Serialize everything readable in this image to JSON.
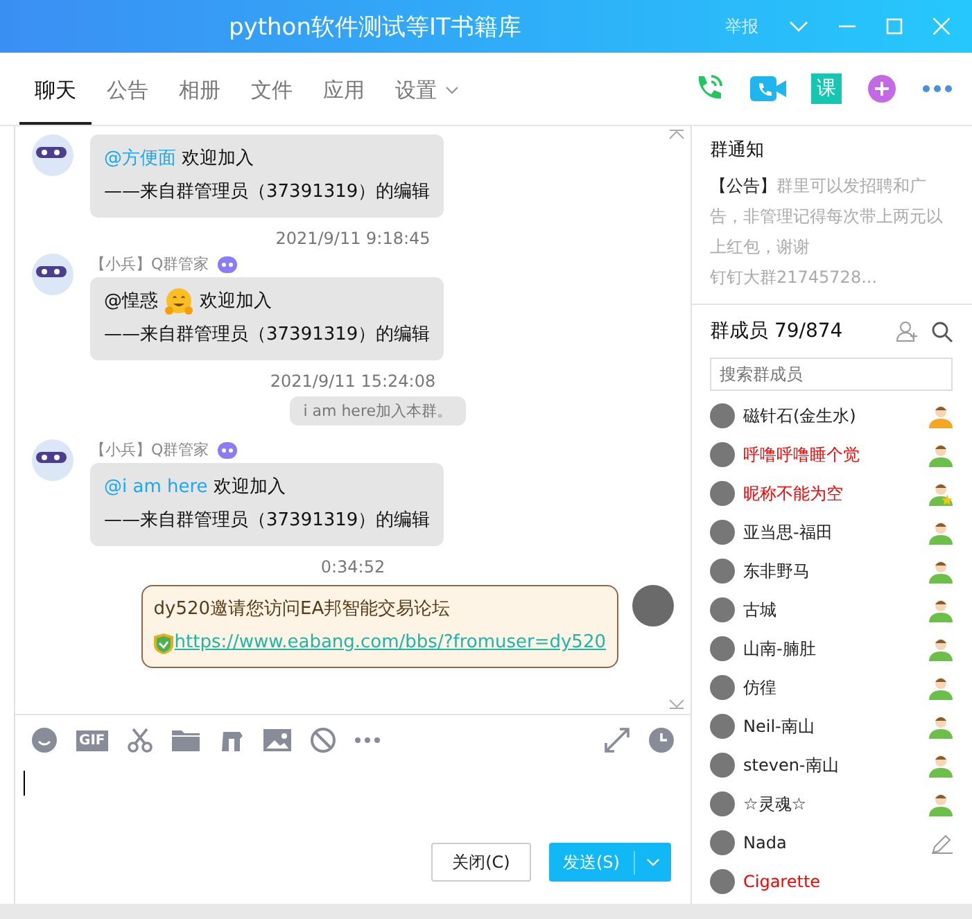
{
  "window": {
    "title": "python软件测试等IT书籍库",
    "report": "举报"
  },
  "tabs": [
    {
      "label": "聊天",
      "selected": true,
      "dropdown": false
    },
    {
      "label": "公告",
      "selected": false,
      "dropdown": false
    },
    {
      "label": "相册",
      "selected": false,
      "dropdown": false
    },
    {
      "label": "文件",
      "selected": false,
      "dropdown": false
    },
    {
      "label": "应用",
      "selected": false,
      "dropdown": false
    },
    {
      "label": "设置",
      "selected": false,
      "dropdown": true
    }
  ],
  "header_actions": [
    {
      "kind": "phone"
    },
    {
      "kind": "video"
    },
    {
      "kind": "lesson",
      "label": "课"
    },
    {
      "kind": "plus"
    },
    {
      "kind": "more"
    }
  ],
  "messages": [
    {
      "kind": "bot",
      "mention": {
        "text": "@方便面",
        "link": true
      },
      "emoji": false,
      "text": "欢迎加入",
      "signature": "——来自群管理员（37391319）的编辑"
    },
    {
      "kind": "time",
      "text": "2021/9/11 9:18:45"
    },
    {
      "kind": "bot",
      "sender": "【小兵】Q群管家",
      "mention": {
        "text": "@惶惑",
        "link": false
      },
      "emoji": true,
      "text": "欢迎加入",
      "signature": "——来自群管理员（37391319）的编辑"
    },
    {
      "kind": "time",
      "text": "2021/9/11 15:24:08"
    },
    {
      "kind": "notice",
      "text": "i am  here加入本群。"
    },
    {
      "kind": "bot",
      "sender": "【小兵】Q群管家",
      "mention": {
        "text": "@i am  here",
        "link": true
      },
      "emoji": false,
      "text": "欢迎加入",
      "signature": "——来自群管理员（37391319）的编辑"
    },
    {
      "kind": "time",
      "text": "0:34:52"
    },
    {
      "kind": "own",
      "text": "dy520邀请您访问EA邦智能交易论坛",
      "link": "https://www.eabang.com/bbs/?fromuser=dy520"
    }
  ],
  "toolbar": [
    {
      "kind": "emoji"
    },
    {
      "kind": "gif",
      "label": "GIF"
    },
    {
      "kind": "scissors"
    },
    {
      "kind": "folder"
    },
    {
      "kind": "music"
    },
    {
      "kind": "image"
    },
    {
      "kind": "block"
    },
    {
      "kind": "more"
    }
  ],
  "buttons": {
    "close": "关闭(C)",
    "send": "发送(S)"
  },
  "notice": {
    "title": "群通知",
    "tag": "【公告】",
    "body": "群里可以发招聘和广告，非管理记得每次带上两元以上红包，谢谢",
    "more": "钉钉大群21745728..."
  },
  "members": {
    "title": "群成员 79/874",
    "search": {
      "placeholder": "搜索群成员"
    },
    "items": [
      {
        "name": "磁针石(金生水)",
        "color": "#222222",
        "kind": "owner"
      },
      {
        "name": "呼噜呼噜睡个觉",
        "color": "#ff0000",
        "kind": "admin"
      },
      {
        "name": "昵称不能为空",
        "color": "#ff0000",
        "kind": "starred"
      },
      {
        "name": "亚当思-福田",
        "color": "#222222",
        "kind": "admin"
      },
      {
        "name": "东非野马",
        "color": "#222222",
        "kind": "admin"
      },
      {
        "name": "古城",
        "color": "#222222",
        "kind": "admin"
      },
      {
        "name": "山南-腩肚",
        "color": "#222222",
        "kind": "admin"
      },
      {
        "name": "仿徨",
        "color": "#222222",
        "kind": "admin"
      },
      {
        "name": "Neil-南山",
        "color": "#222222",
        "kind": "admin"
      },
      {
        "name": "steven-南山",
        "color": "#222222",
        "kind": "admin"
      },
      {
        "name": "☆灵魂☆",
        "color": "#222222",
        "kind": "admin"
      },
      {
        "name": "Nada",
        "color": "#222222",
        "kind": "edit"
      },
      {
        "name": "Cigarette",
        "color": "#ff0000",
        "kind": "plain"
      }
    ]
  }
}
